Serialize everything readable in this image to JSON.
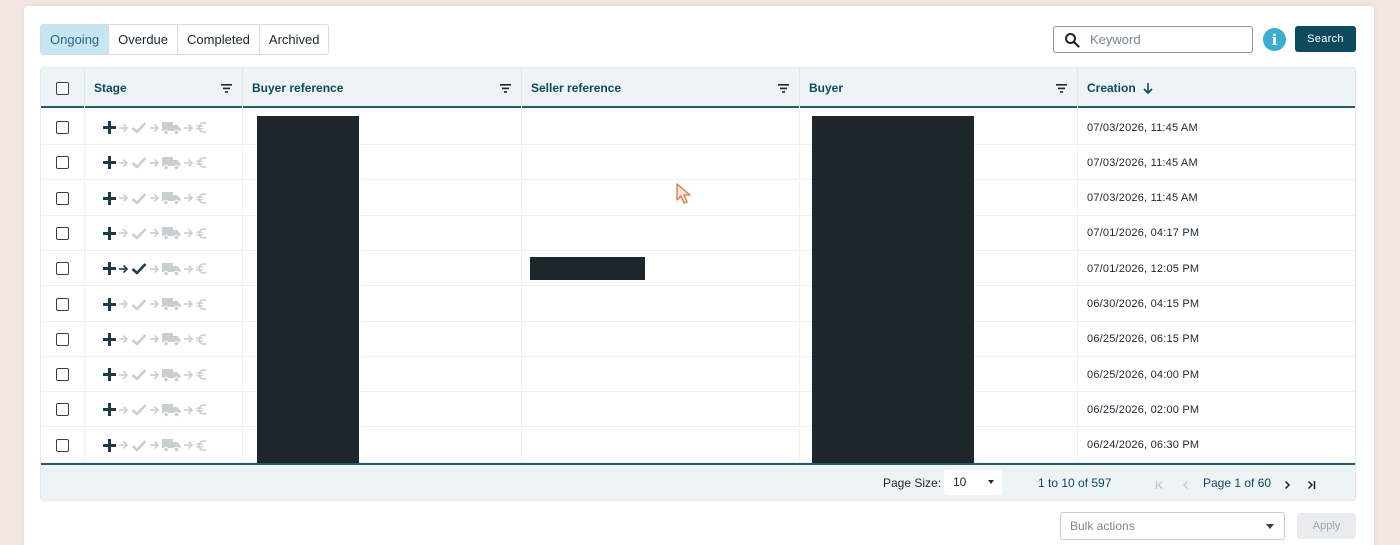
{
  "tabs": [
    {
      "label": "Ongoing",
      "active": true
    },
    {
      "label": "Overdue",
      "active": false
    },
    {
      "label": "Completed",
      "active": false
    },
    {
      "label": "Archived",
      "active": false
    }
  ],
  "search": {
    "placeholder": "Keyword",
    "button_label": "Search",
    "info_icon": "info-icon"
  },
  "table": {
    "columns": [
      "Stage",
      "Buyer reference",
      "Seller reference",
      "Buyer",
      "Creation"
    ],
    "sort_column": "Creation",
    "rows": [
      {
        "stage_done": 1,
        "creation": "07/03/2026, 11:45 AM"
      },
      {
        "stage_done": 1,
        "creation": "07/03/2026, 11:45 AM"
      },
      {
        "stage_done": 1,
        "creation": "07/03/2026, 11:45 AM"
      },
      {
        "stage_done": 1,
        "creation": "07/01/2026, 04:17 PM"
      },
      {
        "stage_done": 2,
        "creation": "07/01/2026, 12:05 PM"
      },
      {
        "stage_done": 1,
        "creation": "06/30/2026, 04:15 PM"
      },
      {
        "stage_done": 1,
        "creation": "06/25/2026, 06:15 PM"
      },
      {
        "stage_done": 1,
        "creation": "06/25/2026, 04:00 PM"
      },
      {
        "stage_done": 1,
        "creation": "06/25/2026, 02:00 PM"
      },
      {
        "stage_done": 1,
        "creation": "06/24/2026, 06:30 PM"
      }
    ]
  },
  "pagination": {
    "page_size_label": "Page Size:",
    "page_size": "10",
    "count": "1 to 10 of 597",
    "page_text": "Page 1 of 60"
  },
  "bulk": {
    "placeholder": "Bulk actions",
    "apply_label": "Apply"
  },
  "colors": {
    "accent": "#0d4a5e",
    "active_tab_bg": "#c6e6f1",
    "info": "#3aaed0",
    "redaction": "#1c262b"
  }
}
